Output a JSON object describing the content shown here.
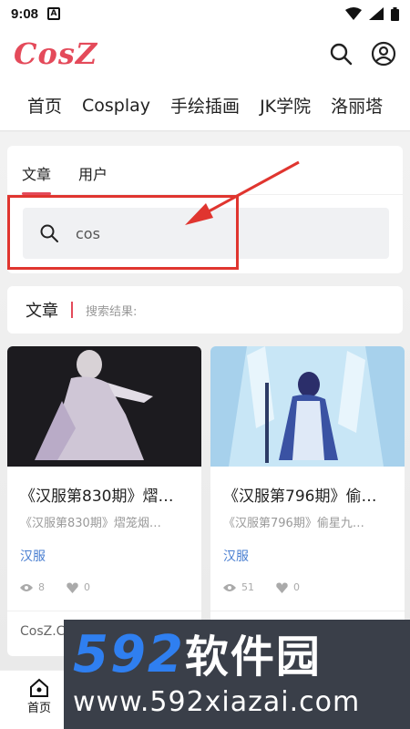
{
  "status_bar": {
    "time": "9:08",
    "notification_glyph": "A"
  },
  "header": {
    "logo": "CosZ"
  },
  "nav": {
    "items": [
      "首页",
      "Cosplay",
      "手绘插画",
      "JK学院",
      "洛丽塔"
    ]
  },
  "search": {
    "tabs": [
      "文章",
      "用户"
    ],
    "active_tab": "文章",
    "query": "cos"
  },
  "results": {
    "title": "文章",
    "subtitle": "搜索结果:"
  },
  "cards": [
    {
      "title": "《汉服第830期》熠…",
      "excerpt": "《汉服第830期》熠笼烟…",
      "category": "汉服",
      "views": "8",
      "likes": "0",
      "footer": "CosZ.C"
    },
    {
      "title": "《汉服第796期》偷…",
      "excerpt": "《汉服第796期》偷星九…",
      "category": "汉服",
      "views": "51",
      "likes": "0",
      "footer": ""
    }
  ],
  "bottom_nav": {
    "home_label": "首页"
  },
  "watermark": {
    "number": "592",
    "cn": "软件园",
    "url": "www.592xiazai.com"
  },
  "colors": {
    "brand": "#e44a5a",
    "link": "#4a7fd1",
    "annotation": "#e0352f"
  }
}
